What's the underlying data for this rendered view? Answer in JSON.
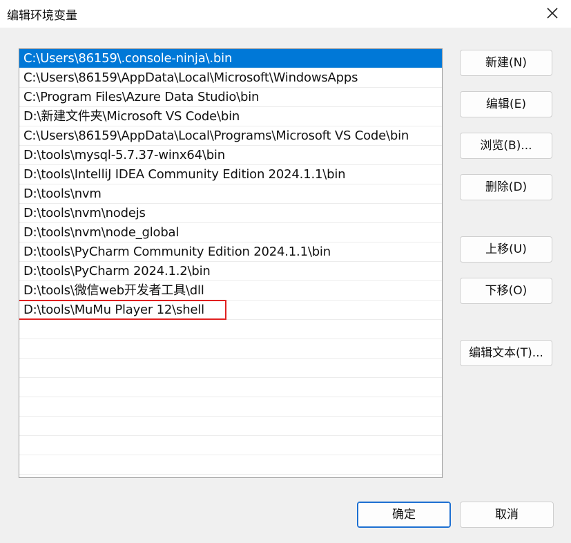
{
  "window": {
    "title": "编辑环境变量"
  },
  "paths": [
    "C:\\Users\\86159\\.console-ninja\\.bin",
    "C:\\Users\\86159\\AppData\\Local\\Microsoft\\WindowsApps",
    "C:\\Program Files\\Azure Data Studio\\bin",
    "D:\\新建文件夹\\Microsoft VS Code\\bin",
    "C:\\Users\\86159\\AppData\\Local\\Programs\\Microsoft VS Code\\bin",
    "D:\\tools\\mysql-5.7.37-winx64\\bin",
    "D:\\tools\\IntelliJ IDEA Community Edition 2024.1.1\\bin",
    "D:\\tools\\nvm",
    "D:\\tools\\nvm\\nodejs",
    "D:\\tools\\nvm\\node_global",
    "D:\\tools\\PyCharm Community Edition 2024.1.1\\bin",
    "D:\\tools\\PyCharm 2024.1.2\\bin",
    "D:\\tools\\微信web开发者工具\\dll",
    "D:\\tools\\MuMu Player 12\\shell"
  ],
  "selected_index": 0,
  "highlighted_index": 13,
  "buttons": {
    "new": "新建(N)",
    "edit": "编辑(E)",
    "browse": "浏览(B)...",
    "delete": "删除(D)",
    "move_up": "上移(U)",
    "move_down": "下移(O)",
    "edit_text": "编辑文本(T)...",
    "ok": "确定",
    "cancel": "取消"
  },
  "colors": {
    "selection": "#0078d7",
    "highlight_box": "#e02020",
    "primary_border": "#1c6fd1"
  },
  "icons": {
    "close": "close-icon"
  }
}
